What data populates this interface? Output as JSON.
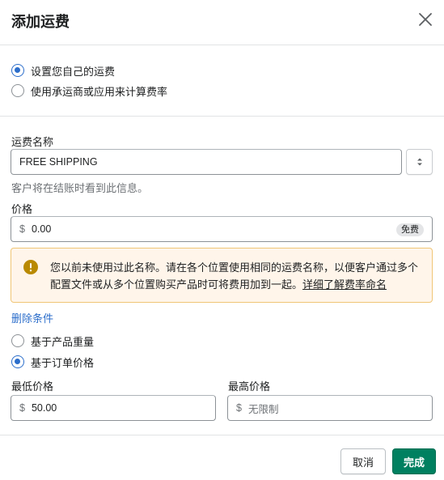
{
  "dialog": {
    "title": "添加运费",
    "rate_type_options": [
      {
        "label": "设置您自己的运费",
        "selected": true
      },
      {
        "label": "使用承运商或应用来计算费率",
        "selected": false
      }
    ],
    "rate_name": {
      "label": "运费名称",
      "value": "FREE SHIPPING",
      "help": "客户将在结账时看到此信息。"
    },
    "price": {
      "label": "价格",
      "prefix": "$",
      "value": "0.00",
      "badge": "免费"
    },
    "warning": {
      "text": "您以前未使用过此名称。请在各个位置使用相同的运费名称，以便客户通过多个配置文件或从多个位置购买产品时可将费用加到一起。",
      "link": "详细了解费率命名"
    },
    "remove_conditions_link": "删除条件",
    "condition_options": [
      {
        "label": "基于产品重量",
        "selected": false
      },
      {
        "label": "基于订单价格",
        "selected": true
      }
    ],
    "min_price": {
      "label": "最低价格",
      "prefix": "$",
      "value": "50.00"
    },
    "max_price": {
      "label": "最高价格",
      "prefix": "$",
      "placeholder": "无限制"
    },
    "buttons": {
      "cancel": "取消",
      "done": "完成"
    }
  },
  "colors": {
    "accent": "#2c6ecb",
    "primary_button": "#008060",
    "warning_bg": "#fff5ea",
    "warning_border": "#f0c676",
    "warning_icon": "#b98900"
  },
  "icons": [
    "close-icon",
    "select-arrows-icon",
    "warning-circle-icon"
  ]
}
